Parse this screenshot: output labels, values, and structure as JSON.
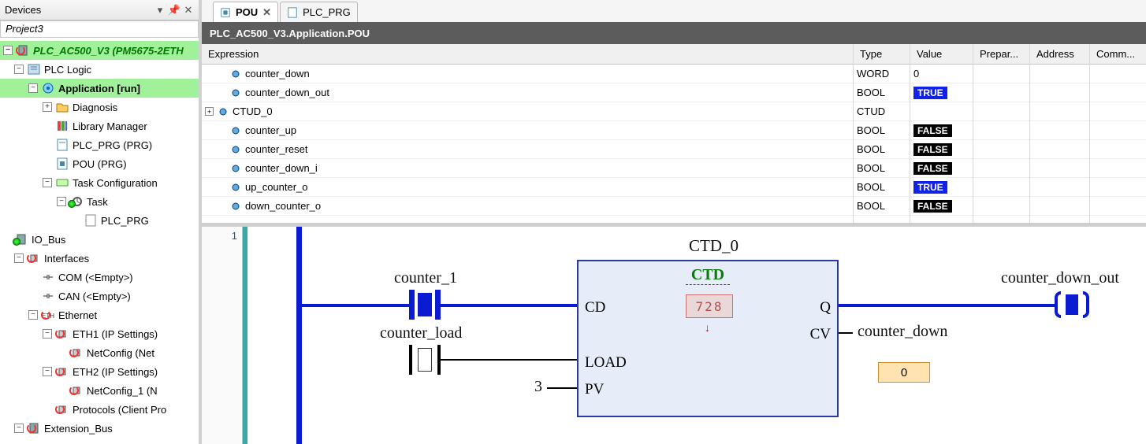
{
  "panel": {
    "title": "Devices",
    "project": "Project3"
  },
  "tree": {
    "root": "PLC_AC500_V3 (PM5675-2ETH",
    "plc_logic": "PLC Logic",
    "application": "Application [run]",
    "diagnosis": "Diagnosis",
    "library_manager": "Library Manager",
    "plc_prg": "PLC_PRG (PRG)",
    "pou": "POU (PRG)",
    "task_cfg": "Task Configuration",
    "task": "Task",
    "task_plc_prg": "PLC_PRG",
    "io_bus": "IO_Bus",
    "interfaces": "Interfaces",
    "com": "COM (<Empty>)",
    "can": "CAN (<Empty>)",
    "ethernet": "Ethernet",
    "eth1": "ETH1 (IP Settings)",
    "netconfig1": "NetConfig (Net",
    "eth2": "ETH2 (IP Settings)",
    "netconfig2": "NetConfig_1 (N",
    "protocols": "Protocols (Client Pro",
    "extension_bus": "Extension_Bus"
  },
  "tabs": {
    "pou": "POU",
    "plc_prg": "PLC_PRG"
  },
  "breadcrumb": "PLC_AC500_V3.Application.POU",
  "headers": {
    "expression": "Expression",
    "type": "Type",
    "value": "Value",
    "prepared": "Prepar...",
    "address": "Address",
    "comment": "Comm..."
  },
  "vars": [
    {
      "name": "counter_down",
      "type": "WORD",
      "value": "0",
      "badge": ""
    },
    {
      "name": "counter_down_out",
      "type": "BOOL",
      "value": "TRUE",
      "badge": "true"
    },
    {
      "name": "CTUD_0",
      "type": "CTUD",
      "value": "",
      "badge": "",
      "expandable": true
    },
    {
      "name": "counter_up",
      "type": "BOOL",
      "value": "FALSE",
      "badge": "false"
    },
    {
      "name": "counter_reset",
      "type": "BOOL",
      "value": "FALSE",
      "badge": "false"
    },
    {
      "name": "counter_down_i",
      "type": "BOOL",
      "value": "FALSE",
      "badge": "false"
    },
    {
      "name": "up_counter_o",
      "type": "BOOL",
      "value": "TRUE",
      "badge": "true"
    },
    {
      "name": "down_counter_o",
      "type": "BOOL",
      "value": "FALSE",
      "badge": "false"
    }
  ],
  "ladder": {
    "rung": "1",
    "instance": "CTD_0",
    "block": "CTD",
    "display": "728",
    "counter_1": "counter_1",
    "counter_load": "counter_load",
    "counter_down_out": "counter_down_out",
    "counter_down": "counter_down",
    "cd": "CD",
    "load": "LOAD",
    "pv": "PV",
    "q": "Q",
    "cv": "CV",
    "pv_val": "3",
    "cv_box": "0"
  }
}
